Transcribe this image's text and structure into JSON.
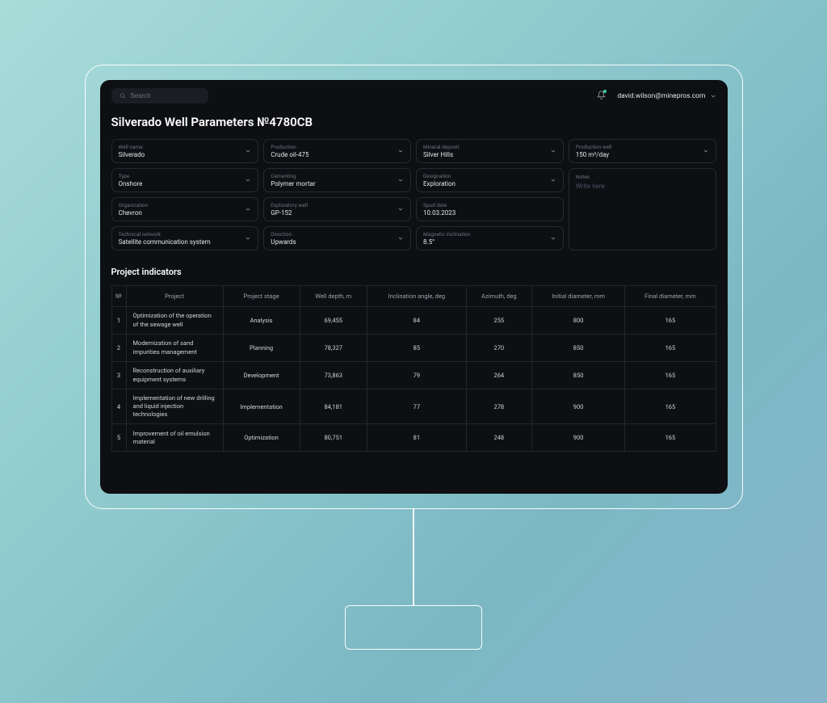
{
  "header": {
    "search_placeholder": "Search",
    "user_email": "david.wilson@minepros.com"
  },
  "page_title": "Silverado Well Parameters №4780CB",
  "fields": {
    "well_name": {
      "label": "Well name",
      "value": "Silverado"
    },
    "production": {
      "label": "Production",
      "value": "Crude oil-475"
    },
    "mineral_deposit": {
      "label": "Mineral deposit",
      "value": "Silver Hills"
    },
    "prod_well": {
      "label": "Production well",
      "value": "150 m³/day"
    },
    "type": {
      "label": "Type",
      "value": "Onshore"
    },
    "cementing": {
      "label": "Cementing",
      "value": "Polymer mortar"
    },
    "designation": {
      "label": "Designation",
      "value": "Exploration"
    },
    "organization": {
      "label": "Organization",
      "value": "Chevron"
    },
    "exploratory": {
      "label": "Exploratory well",
      "value": "GP-152"
    },
    "spud_date": {
      "label": "Spud date",
      "value": "10.03.2023"
    },
    "tech_network": {
      "label": "Technical network",
      "value": "Satellite communication system"
    },
    "direction": {
      "label": "Direction",
      "value": "Upwards"
    },
    "mag_incl": {
      "label": "Magnetic inclination",
      "value": "8.5°"
    },
    "notes": {
      "label": "Notes",
      "placeholder": "Write here"
    }
  },
  "section_title": "Project indicators",
  "table": {
    "headers": [
      "№",
      "Project",
      "Project stage",
      "Well depth, m",
      "Inclination angle, deg",
      "Azimuth, deg",
      "Initial diameter, mm",
      "Final diameter, mm"
    ],
    "rows": [
      {
        "n": "1",
        "project": "Optimization of the operation of the sewage well",
        "stage": "Analysis",
        "depth": "69,455",
        "incl": "84",
        "azimuth": "255",
        "init_d": "800",
        "final_d": "165"
      },
      {
        "n": "2",
        "project": "Modernization of sand impurities management",
        "stage": "Planning",
        "depth": "78,327",
        "incl": "85",
        "azimuth": "270",
        "init_d": "850",
        "final_d": "165"
      },
      {
        "n": "3",
        "project": "Reconstruction of auxiliary equipment systems",
        "stage": "Development",
        "depth": "73,863",
        "incl": "79",
        "azimuth": "264",
        "init_d": "850",
        "final_d": "165"
      },
      {
        "n": "4",
        "project": "Implementation of new drilling and liquid injection technologies",
        "stage": "Implementation",
        "depth": "84,181",
        "incl": "77",
        "azimuth": "278",
        "init_d": "900",
        "final_d": "165"
      },
      {
        "n": "5",
        "project": "Improvement of oil emulsion material",
        "stage": "Optimization",
        "depth": "80,751",
        "incl": "81",
        "azimuth": "248",
        "init_d": "900",
        "final_d": "165"
      }
    ]
  }
}
